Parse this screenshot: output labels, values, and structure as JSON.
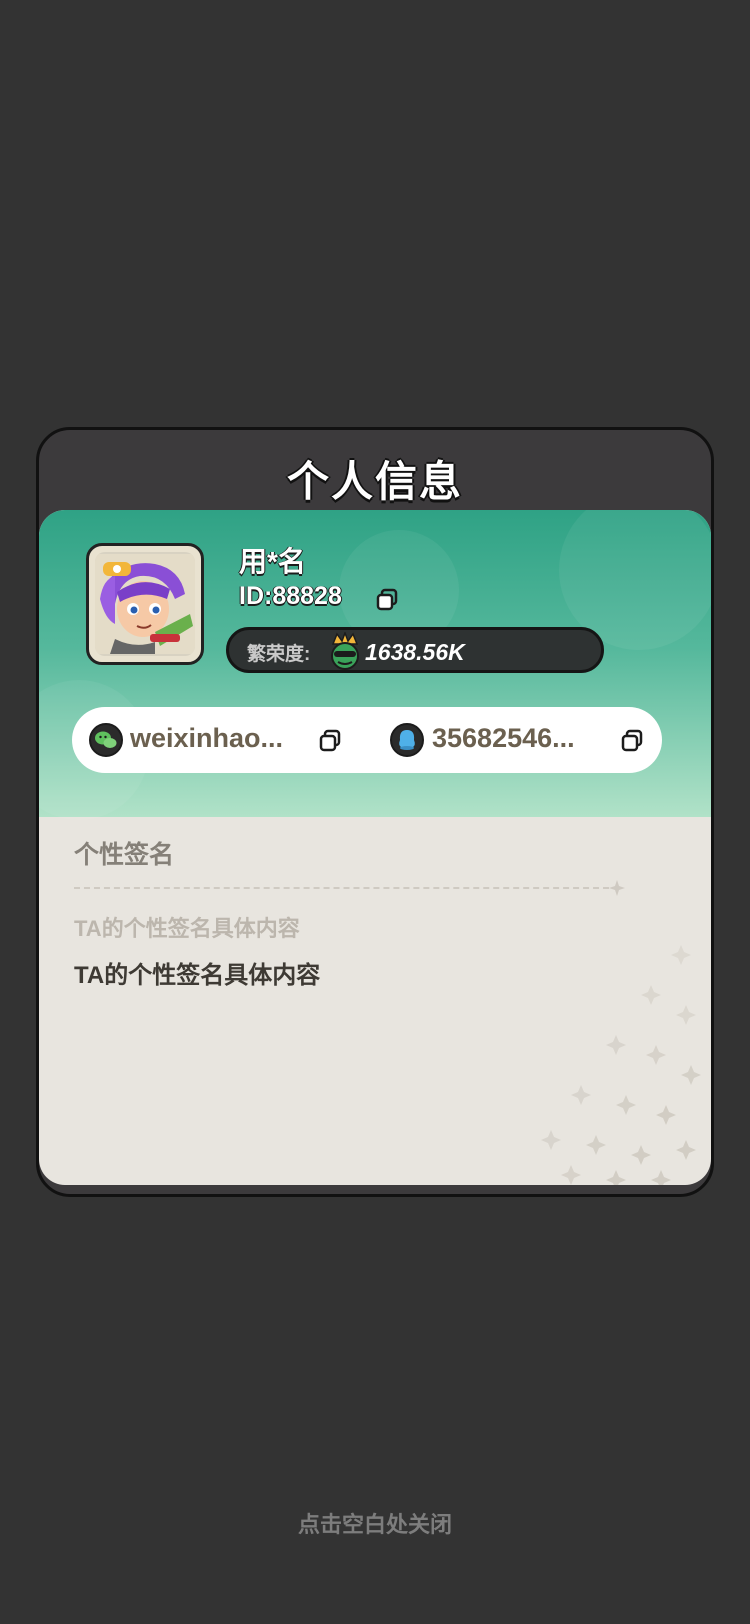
{
  "dialog": {
    "title": "个人信息"
  },
  "profile": {
    "username": "用*名",
    "id_text": "ID:88828",
    "prosperity_label": "繁荣度:",
    "prosperity_value": "1638.56K"
  },
  "social": {
    "wechat": {
      "icon": "wechat-icon",
      "value": "weixinhao..."
    },
    "qq": {
      "icon": "qq-icon",
      "value": "35682546..."
    }
  },
  "signature": {
    "title": "个性签名",
    "placeholder": "TA的个性签名具体内容",
    "content": "TA的个性签名具体内容"
  },
  "close_hint": "点击空白处关闭",
  "colors": {
    "background": "#333333",
    "header_green": "#2fa285",
    "panel_beige": "#e8e5df",
    "prosperity_bar": "#2e3232"
  }
}
